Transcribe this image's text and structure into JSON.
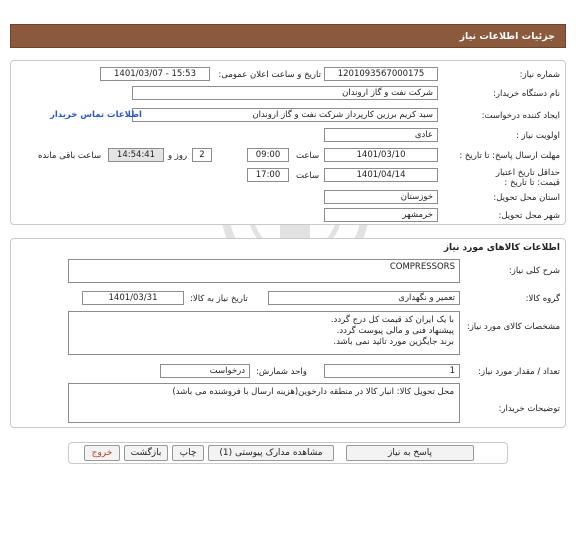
{
  "header": {
    "title": "جزئیات اطلاعات نیاز"
  },
  "info": {
    "need_number_label": "شماره نیاز:",
    "need_number": "1201093567000175",
    "announce_label": "تاریخ و ساعت اعلان عمومی:",
    "announce_value": "1401/03/07 - 15:53",
    "buyer_label": "نام دستگاه خریدار:",
    "buyer": "شرکت نفت و گاز اروندان",
    "creator_label": "ایجاد کننده درخواست:",
    "creator": "سید کریم برزین کارپرداز شرکت نفت و گاز اروندان",
    "contact_link": "اطلاعات تماس خریدار",
    "priority_label": "اولویت نیاز :",
    "priority": "عادی",
    "deadline_label": "مهلت ارسال پاسخ: تا تاریخ :",
    "deadline_date": "1401/03/10",
    "time_label": "ساعت",
    "deadline_time": "09:00",
    "days_value": "2",
    "days_label": "روز و",
    "remaining_time": "14:54:41",
    "remaining_label": "ساعت باقی مانده",
    "validity_label": "حداقل تاریخ اعتبار قیمت: تا تاریخ :",
    "validity_date": "1401/04/14",
    "validity_time": "17:00",
    "province_label": "استان محل تحویل:",
    "province": "خوزستان",
    "city_label": "شهر محل تحویل:",
    "city": "خرمشهر"
  },
  "goods": {
    "section_title": "اطلاعات کالاهای مورد نیاز",
    "summary_label": "شرح کلی نیاز:",
    "summary": "COMPRESSORS",
    "group_label": "گروه کالا:",
    "group": "تعمیر و نگهداری",
    "need_date_label": "تاریخ نیاز به کالا:",
    "need_date": "1401/03/31",
    "spec_label": "مشخصات کالای مورد نیاز:",
    "spec_lines": [
      "با یک ایران کد قیمت کل درج گردد.",
      "پیشنهاد فنی و مالی پیوست گردد.",
      "برند جایگزین مورد تائید نمی باشد."
    ],
    "qty_label": "تعداد / مقدار مورد نیاز:",
    "qty": "1",
    "unit_label": "واحد شمارش:",
    "unit": "درخواست",
    "notes_label": "توضیحات خریدار:",
    "notes": "محل تحویل کالا: انبار کالا در منطقه دارخوین(هزینه ارسال با فروشنده می باشد)"
  },
  "buttons": {
    "reply": "پاسخ به نیاز",
    "attachments": "مشاهده مدارک پیوستی (1)",
    "print": "چاپ",
    "back": "بازگشت",
    "exit": "خروج"
  },
  "colors": {
    "header_bg": "#8b5a3c",
    "link": "#2a56c6",
    "exit_text": "#c0392b"
  }
}
